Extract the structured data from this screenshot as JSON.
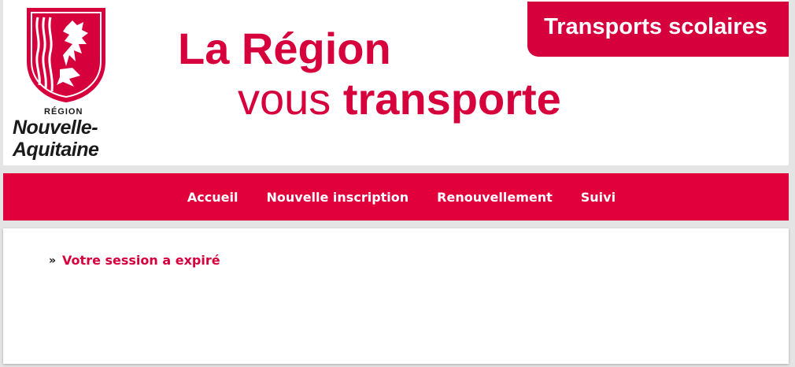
{
  "header": {
    "logo": {
      "region_label": "RÉGION",
      "name_line1": "Nouvelle-",
      "name_line2": "Aquitaine",
      "icon": "lion-shield-icon"
    },
    "slogan_line1": "La Région",
    "slogan_line2_plain": "vous ",
    "slogan_line2_bold": "transporte",
    "badge": "Transports scolaires"
  },
  "nav": {
    "items": [
      {
        "label": "Accueil"
      },
      {
        "label": "Nouvelle inscription"
      },
      {
        "label": "Renouvellement"
      },
      {
        "label": "Suivi"
      }
    ]
  },
  "main": {
    "message_icon": "double-chevron-right-icon",
    "message": "Votre session a expiré"
  },
  "colors": {
    "brand_red": "#d6003d",
    "nav_red": "#e1003c",
    "background": "#e4e4e4"
  }
}
